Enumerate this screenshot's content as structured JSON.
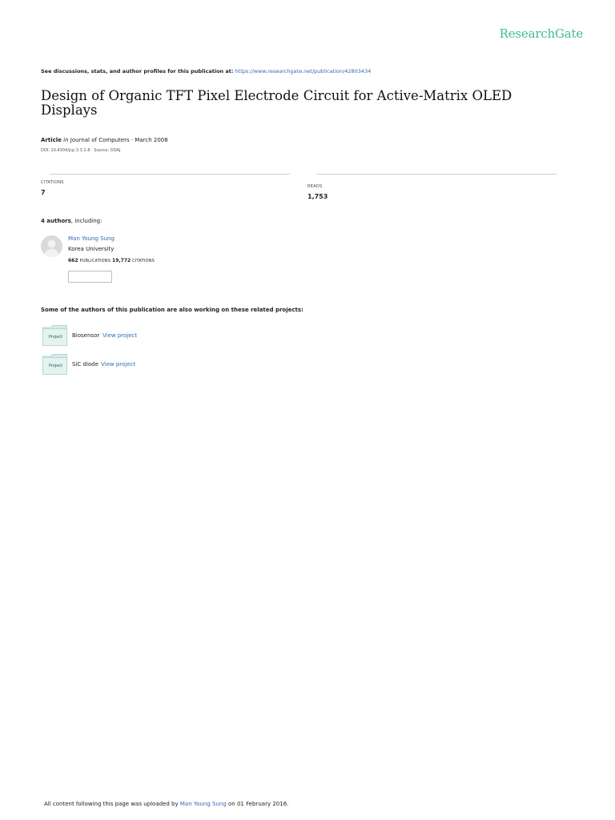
{
  "header": {
    "logo": "ResearchGate"
  },
  "discussion": {
    "text": "See discussions, stats, and author profiles for this publication at:",
    "url": "https://www.researchgate.net/publication/42803434"
  },
  "publication": {
    "title": "Design of Organic TFT Pixel Electrode Circuit for Active-Matrix OLED Displays",
    "type": "Article",
    "in_word": "in",
    "journal_date": "Journal of Computers · March 2008",
    "doi_source": "DOI: 10.4304/jcp.3.3.1-8 · Source: DOAJ"
  },
  "stats": {
    "citations_label": "CITATIONS",
    "citations_value": "7",
    "reads_label": "READS",
    "reads_value": "1,753"
  },
  "authors": {
    "count": "4 authors",
    "suffix": ", including:",
    "list": [
      {
        "name": "Man Young Sung",
        "institution": "Korea University",
        "publications": "662",
        "publications_label": "PUBLICATIONS",
        "citations": "19,772",
        "citations_label": "CITATIONS"
      }
    ]
  },
  "related": {
    "heading": "Some of the authors of this publication are also working on these related projects:",
    "projects": [
      {
        "icon_label": "Project",
        "name": "Biosensor",
        "link": "View project"
      },
      {
        "icon_label": "Project",
        "name": "SiC diode",
        "link": "View project"
      }
    ]
  },
  "footer": {
    "prefix": "All content following this page was uploaded by",
    "uploader": "Man Young Sung",
    "suffix": "on 01 February 2016."
  },
  "colors": {
    "brand": "#40ba9b",
    "link": "#2f6bb0",
    "project_icon_fill": "#d6ece7"
  }
}
